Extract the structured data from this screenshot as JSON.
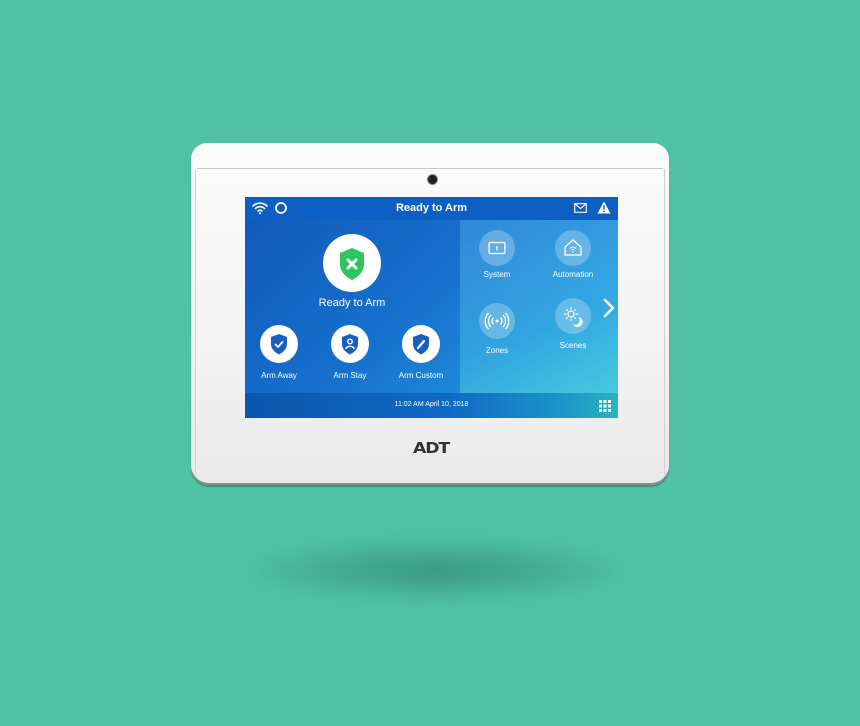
{
  "device": {
    "brand_logo": "ADT",
    "camera": "front-camera"
  },
  "screen": {
    "topbar": {
      "title": "Ready to Arm",
      "left_icons": [
        "wifi-icon",
        "alexa-ring-icon"
      ],
      "right_icons": [
        "mail-icon",
        "warning-icon"
      ]
    },
    "status": {
      "label": "Ready to Arm",
      "icon": "shield-x-icon",
      "color": "#2ec45f"
    },
    "arm_buttons": [
      {
        "label": "Arm Away",
        "icon": "shield-check-icon"
      },
      {
        "label": "Arm Stay",
        "icon": "shield-person-icon"
      },
      {
        "label": "Arm Custom",
        "icon": "shield-pencil-icon"
      }
    ],
    "tiles": [
      {
        "label": "System",
        "icon": "info-box-icon"
      },
      {
        "label": "Automation",
        "icon": "smart-home-icon"
      },
      {
        "label": "Zones",
        "icon": "signal-waves-icon"
      },
      {
        "label": "Scenes",
        "icon": "sun-moon-icon"
      }
    ],
    "next_page": "chevron-right-icon",
    "bottombar": {
      "datetime": "11:02 AM April 10, 2018",
      "menu_icon": "grid-menu-icon"
    }
  },
  "colors": {
    "background": "#4fc1a4",
    "screen_blue": "#1266c4",
    "shield_blue": "#1a5fbf",
    "status_green": "#2ec45f"
  }
}
